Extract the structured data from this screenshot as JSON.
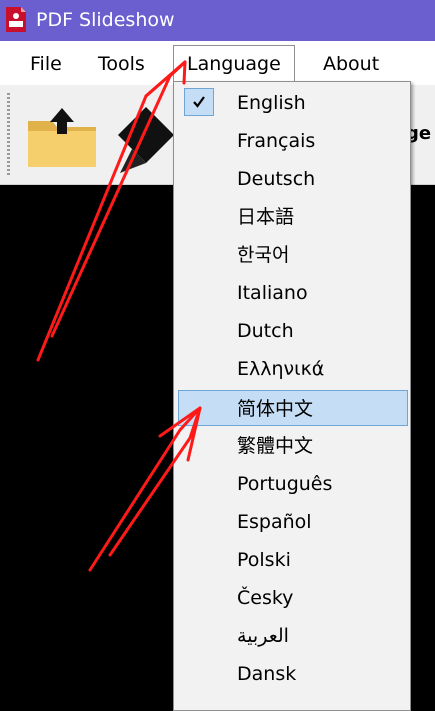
{
  "window": {
    "title": "PDF Slideshow",
    "icon": "pdf-app-icon",
    "accent": "#6b5fcf"
  },
  "menubar": {
    "items": [
      "File",
      "Tools",
      "Language",
      "About"
    ],
    "open_menu": "Language"
  },
  "toolbar": {
    "trailing_text": "ge"
  },
  "language_menu": {
    "items": [
      {
        "label": "English",
        "checked": true
      },
      {
        "label": "Français"
      },
      {
        "label": "Deutsch"
      },
      {
        "label": "日本語"
      },
      {
        "label": "한국어"
      },
      {
        "label": "Italiano"
      },
      {
        "label": "Dutch"
      },
      {
        "label": "Ελληνικά"
      },
      {
        "label": "简体中文",
        "highlighted": true
      },
      {
        "label": "繁體中文"
      },
      {
        "label": "Português"
      },
      {
        "label": "Español"
      },
      {
        "label": "Polski"
      },
      {
        "label": "Česky"
      },
      {
        "label": "العربية"
      },
      {
        "label": "Dansk"
      }
    ],
    "highlight_color": "#c6def5",
    "annotation_color": "#ff1a1a"
  }
}
